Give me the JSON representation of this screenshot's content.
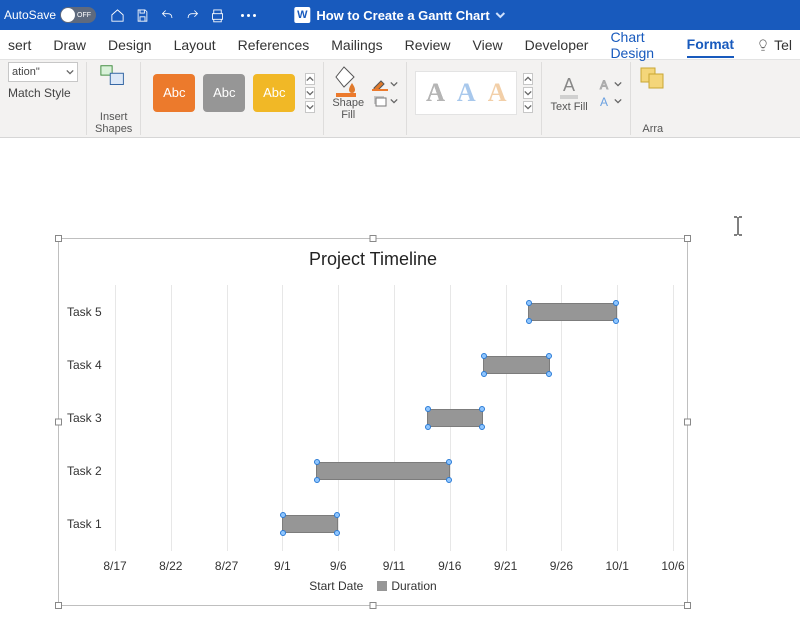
{
  "titlebar": {
    "autosave_label": "AutoSave",
    "autosave_state": "OFF",
    "doc_title": "How to Create a Gantt Chart"
  },
  "tabs": {
    "items": [
      "sert",
      "Draw",
      "Design",
      "Layout",
      "References",
      "Mailings",
      "Review",
      "View",
      "Developer",
      "Chart Design",
      "Format"
    ],
    "active_index": 10,
    "context_indices": [
      9,
      10
    ],
    "tell_me": "Tel"
  },
  "ribbon": {
    "group0": {
      "combo": "ation\"",
      "link": "Match Style"
    },
    "group1": {
      "caption": "Insert\nShapes"
    },
    "group2": {
      "swatch_text": "Abc"
    },
    "group3": {
      "caption": "Shape\nFill"
    },
    "group4": {
      "letter": "A"
    },
    "group5": {
      "caption": "Text Fill"
    },
    "group6": {
      "caption": "Arra"
    }
  },
  "chart_data": {
    "type": "bar",
    "title": "Project Timeline",
    "orientation": "horizontal-stacked",
    "x_axis": {
      "label": "",
      "ticks": [
        "8/17",
        "8/22",
        "8/27",
        "9/1",
        "9/6",
        "9/11",
        "9/16",
        "9/21",
        "9/26",
        "10/1",
        "10/6"
      ],
      "range_days": [
        0,
        50
      ]
    },
    "y_axis": {
      "label": "",
      "categories": [
        "Task 5",
        "Task 4",
        "Task 3",
        "Task 2",
        "Task 1"
      ]
    },
    "series": [
      {
        "name": "Start Date",
        "values_offset_days": [
          37,
          33,
          28,
          18,
          15
        ],
        "note": "Days after 8/17 where each bar begins; series rendered invisible"
      },
      {
        "name": "Duration",
        "values_days": [
          8,
          6,
          5,
          12,
          5
        ]
      }
    ],
    "legend": [
      "Start Date",
      "Duration"
    ],
    "selected_series": "Duration"
  }
}
